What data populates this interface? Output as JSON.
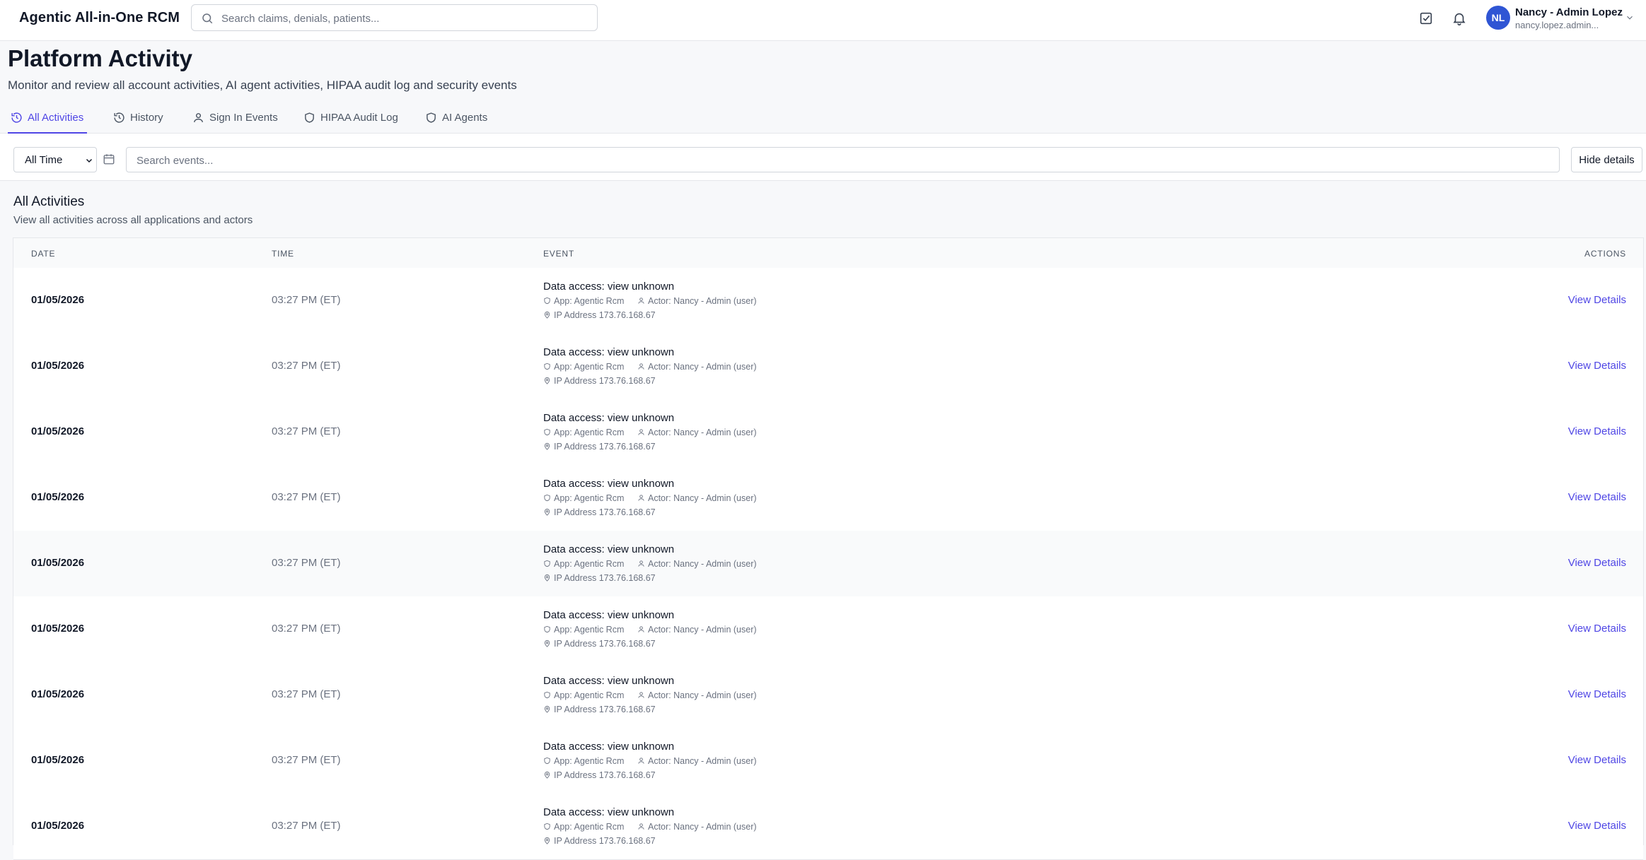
{
  "header": {
    "app_title": "Agentic All-in-One RCM",
    "search_placeholder": "Search claims, denials, patients...",
    "user": {
      "initials": "NL",
      "name": "Nancy - Admin Lopez",
      "email": "nancy.lopez.admin..."
    },
    "icons": [
      "tasks-icon",
      "bell-icon"
    ]
  },
  "page": {
    "title": "Platform Activity",
    "subtitle": "Monitor and review all account activities, AI agent activities, HIPAA audit log and security events"
  },
  "tabs": [
    {
      "label": "All Activities",
      "icon": "history-icon",
      "active": true
    },
    {
      "label": "History",
      "icon": "history-icon",
      "active": false
    },
    {
      "label": "Sign In Events",
      "icon": "user-icon",
      "active": false
    },
    {
      "label": "HIPAA Audit Log",
      "icon": "shield-icon",
      "active": false
    },
    {
      "label": "AI Agents",
      "icon": "shield-icon",
      "active": false
    }
  ],
  "filters": {
    "time_range": "All Time",
    "search_placeholder": "Search events...",
    "hide_details_label": "Hide details"
  },
  "section": {
    "title": "All Activities",
    "subtitle": "View all activities across all applications and actors"
  },
  "table": {
    "columns": {
      "date": "DATE",
      "time": "TIME",
      "event": "EVENT",
      "actions": "ACTIONS"
    },
    "action_label": "View Details",
    "rows": [
      {
        "date": "01/05/2026",
        "time": "03:27 PM (ET)",
        "event": "Data access: view unknown",
        "app": "App: Agentic Rcm",
        "actor": "Actor: Nancy - Admin (user)",
        "ip": "IP Address 173.76.168.67"
      },
      {
        "date": "01/05/2026",
        "time": "03:27 PM (ET)",
        "event": "Data access: view unknown",
        "app": "App: Agentic Rcm",
        "actor": "Actor: Nancy - Admin (user)",
        "ip": "IP Address 173.76.168.67"
      },
      {
        "date": "01/05/2026",
        "time": "03:27 PM (ET)",
        "event": "Data access: view unknown",
        "app": "App: Agentic Rcm",
        "actor": "Actor: Nancy - Admin (user)",
        "ip": "IP Address 173.76.168.67"
      },
      {
        "date": "01/05/2026",
        "time": "03:27 PM (ET)",
        "event": "Data access: view unknown",
        "app": "App: Agentic Rcm",
        "actor": "Actor: Nancy - Admin (user)",
        "ip": "IP Address 173.76.168.67"
      },
      {
        "date": "01/05/2026",
        "time": "03:27 PM (ET)",
        "event": "Data access: view unknown",
        "app": "App: Agentic Rcm",
        "actor": "Actor: Nancy - Admin (user)",
        "ip": "IP Address 173.76.168.67",
        "highlighted": true
      },
      {
        "date": "01/05/2026",
        "time": "03:27 PM (ET)",
        "event": "Data access: view unknown",
        "app": "App: Agentic Rcm",
        "actor": "Actor: Nancy - Admin (user)",
        "ip": "IP Address 173.76.168.67"
      },
      {
        "date": "01/05/2026",
        "time": "03:27 PM (ET)",
        "event": "Data access: view unknown",
        "app": "App: Agentic Rcm",
        "actor": "Actor: Nancy - Admin (user)",
        "ip": "IP Address 173.76.168.67"
      },
      {
        "date": "01/05/2026",
        "time": "03:27 PM (ET)",
        "event": "Data access: view unknown",
        "app": "App: Agentic Rcm",
        "actor": "Actor: Nancy - Admin (user)",
        "ip": "IP Address 173.76.168.67"
      },
      {
        "date": "01/05/2026",
        "time": "03:27 PM (ET)",
        "event": "Data access: view unknown",
        "app": "App: Agentic Rcm",
        "actor": "Actor: Nancy - Admin (user)",
        "ip": "IP Address 173.76.168.67"
      }
    ]
  },
  "colors": {
    "accent": "#4f46e5",
    "avatar": "#2f55d4",
    "border": "#e5e7eb",
    "muted_text": "#6b7280"
  }
}
